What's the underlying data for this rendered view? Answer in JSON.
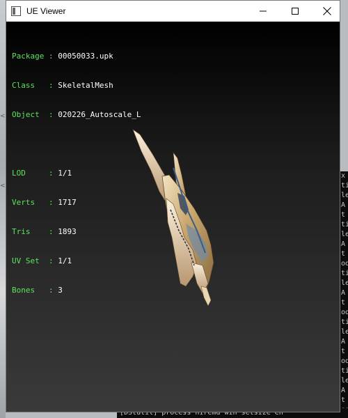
{
  "window": {
    "title": "UE Viewer",
    "controls": {
      "minimize": "minimize",
      "maximize": "maximize",
      "close": "close"
    }
  },
  "info": {
    "package": {
      "key": "Package",
      "value": "00050033.upk"
    },
    "class": {
      "key": "Class  ",
      "value": "SkeletalMesh"
    },
    "object": {
      "key": "Object ",
      "value": "020226_Autoscale_L"
    },
    "lod": {
      "key": "LOD    ",
      "value": "1/1"
    },
    "verts": {
      "key": "Verts  ",
      "value": "1717"
    },
    "tris": {
      "key": "Tris   ",
      "value": "1893"
    },
    "uvset": {
      "key": "UV Set ",
      "value": "1/1"
    },
    "bones": {
      "key": "Bones  ",
      "value": "3"
    },
    "separator": " : "
  },
  "background_console": {
    "edge_chars": [
      "x",
      "ti",
      "le",
      "A",
      "t",
      "ti",
      "le",
      "A",
      "t",
      "od",
      "ti",
      "le",
      "A",
      "t",
      "od",
      "ti",
      "le",
      "A",
      "t",
      "od",
      "ti",
      "le",
      "A",
      "t",
      "od"
    ],
    "bottom_line": "[DStutil] process  hiremd win setsize  en"
  },
  "colors": {
    "key_text": "#5ee35e",
    "value_text": "#ffffff",
    "viewport_top": "#000000",
    "viewport_bottom": "#3a3a3a"
  }
}
